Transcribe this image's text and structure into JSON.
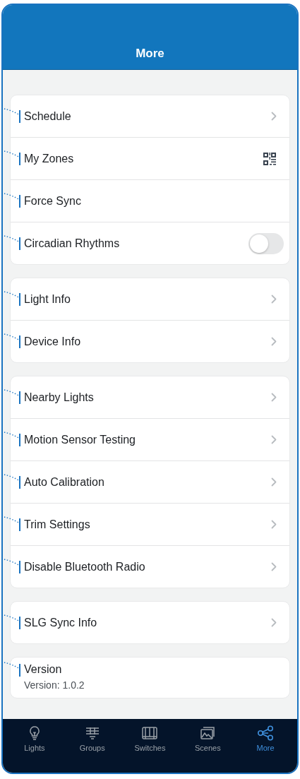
{
  "header": {
    "title": "More"
  },
  "groups": [
    {
      "rows": [
        {
          "label": "Schedule",
          "kind": "chevron"
        },
        {
          "label": "My Zones",
          "kind": "qr"
        },
        {
          "label": "Force Sync",
          "kind": "plain"
        },
        {
          "label": "Circadian Rhythms",
          "kind": "toggle",
          "on": false
        }
      ]
    },
    {
      "rows": [
        {
          "label": "Light Info",
          "kind": "chevron"
        },
        {
          "label": "Device Info",
          "kind": "chevron"
        }
      ]
    },
    {
      "rows": [
        {
          "label": "Nearby Lights",
          "kind": "chevron"
        },
        {
          "label": "Motion Sensor Testing",
          "kind": "chevron"
        },
        {
          "label": "Auto Calibration",
          "kind": "chevron"
        },
        {
          "label": "Trim Settings",
          "kind": "chevron"
        },
        {
          "label": "Disable Bluetooth Radio",
          "kind": "chevron"
        }
      ]
    },
    {
      "rows": [
        {
          "label": "SLG Sync Info",
          "kind": "chevron"
        }
      ]
    },
    {
      "rows": [
        {
          "label": "Version",
          "kind": "subtitle",
          "subtitle": "Version: 1.0.2"
        }
      ]
    }
  ],
  "tabs": [
    {
      "label": "Lights",
      "kind": "bulb",
      "selected": false
    },
    {
      "label": "Groups",
      "kind": "groups",
      "selected": false
    },
    {
      "label": "Switches",
      "kind": "switch",
      "selected": false
    },
    {
      "label": "Scenes",
      "kind": "scenes",
      "selected": false
    },
    {
      "label": "More",
      "kind": "share",
      "selected": true
    }
  ]
}
